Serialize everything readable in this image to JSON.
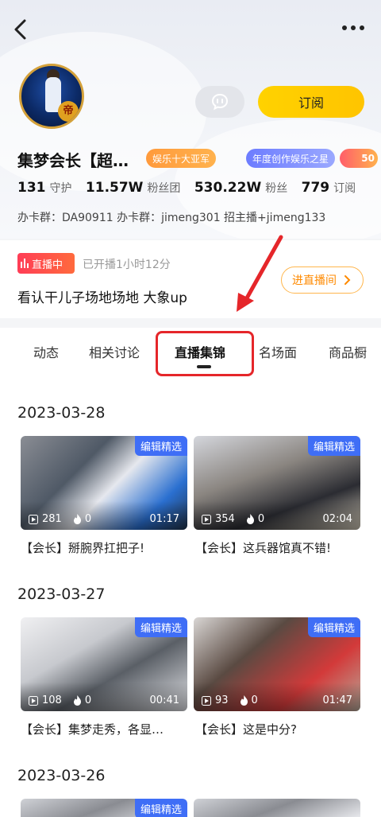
{
  "nav": {
    "back_icon": "chevron-left-icon",
    "more_icon": "more-dots-icon"
  },
  "profile": {
    "avatar_badge": "帝",
    "subscribe_label": "订阅",
    "chat_icon": "chat-bubble-icon",
    "name": "集梦会长【超…",
    "medals": [
      "娱乐十大亚军",
      "年度创作娱乐之星",
      "50"
    ],
    "stats": [
      {
        "value": "131",
        "label": "守护"
      },
      {
        "value": "11.57W",
        "label": "粉丝团"
      },
      {
        "value": "530.22W",
        "label": "粉丝"
      },
      {
        "value": "779",
        "label": "订阅"
      }
    ],
    "group_info": "办卡群：DA90911 办卡群：jimeng301  招主播+jimeng133"
  },
  "live": {
    "badge": "直播中",
    "elapsed": "已开播1小时12分",
    "title": "看认干儿子场地场地 大象up",
    "enter_label": "进直播间"
  },
  "tabs": [
    "动态",
    "相关讨论",
    "直播集锦",
    "名场面",
    "商品橱"
  ],
  "active_tab": "直播集锦",
  "sections": [
    {
      "date": "2023-03-28",
      "videos": [
        {
          "tag": "编辑精选",
          "plays": "281",
          "likes": "0",
          "duration": "01:17",
          "title": "【会长】掰腕界扛把子!"
        },
        {
          "tag": "编辑精选",
          "plays": "354",
          "likes": "0",
          "duration": "02:04",
          "title": "【会长】这兵器馆真不错!"
        }
      ]
    },
    {
      "date": "2023-03-27",
      "videos": [
        {
          "tag": "编辑精选",
          "plays": "108",
          "likes": "0",
          "duration": "00:41",
          "title": "【会长】集梦走秀，各显…"
        },
        {
          "tag": "编辑精选",
          "plays": "93",
          "likes": "0",
          "duration": "01:47",
          "title": "【会长】这是中分?"
        }
      ]
    },
    {
      "date": "2023-03-26",
      "videos": [
        {
          "tag": "编辑精选"
        }
      ]
    }
  ],
  "colors": {
    "accent_yellow": "#ffd200",
    "live_red": "#ff3d56",
    "tag_blue": "#3f6ef6",
    "highlight_red": "#e5262a"
  }
}
